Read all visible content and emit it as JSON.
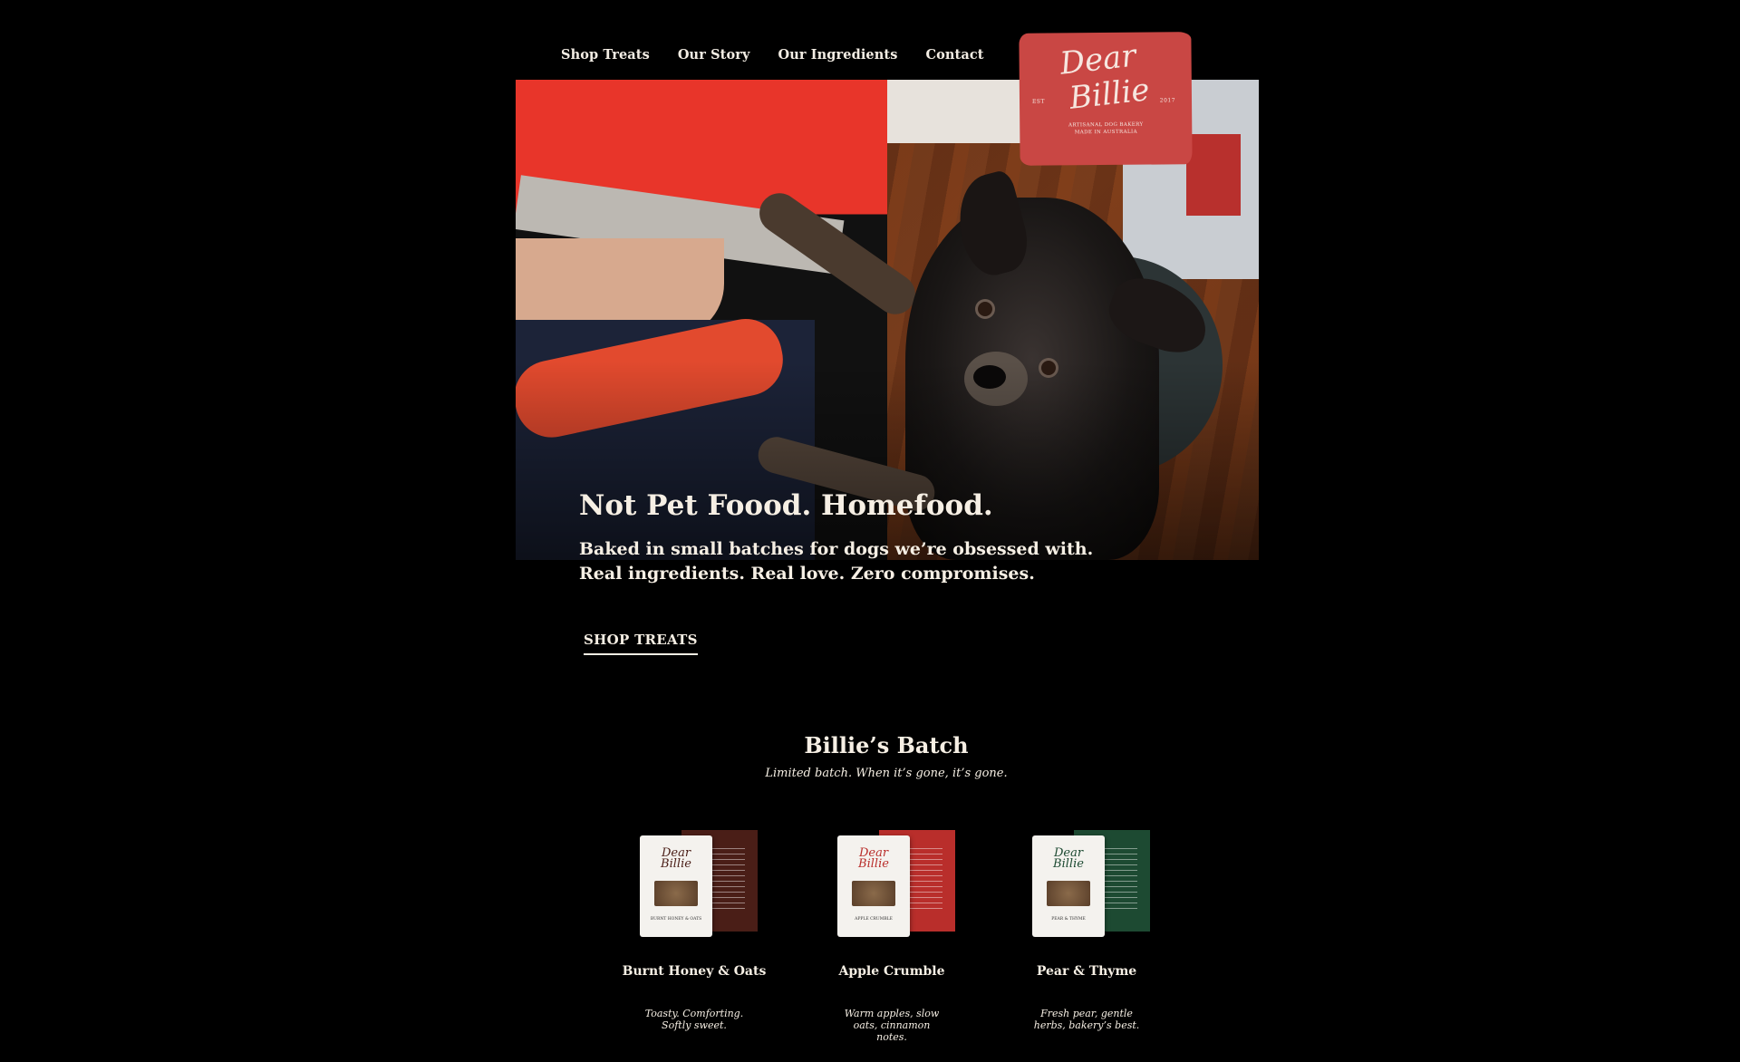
{
  "nav": {
    "items": [
      {
        "label": "Shop Treats"
      },
      {
        "label": "Our Story"
      },
      {
        "label": "Our Ingredients"
      },
      {
        "label": "Contact"
      }
    ]
  },
  "logo": {
    "line1": "Dear",
    "line2": "Billie",
    "est": "EST",
    "year": "2017",
    "tagline1": "ARTISANAL DOG BAKERY",
    "tagline2": "MADE IN AUSTRALIA"
  },
  "hero": {
    "headline": "Not Pet Foood. Homefood.",
    "lede_line1": "Baked in small batches for dogs we’re obsessed with.",
    "lede_line2": "Real ingredients. Real love. Zero compromises.",
    "cta_label": "SHOP TREATS"
  },
  "batch": {
    "title": "Billie’s Batch",
    "subtitle": "Limited batch. When it’s gone, it’s gone."
  },
  "products": [
    {
      "name": "Burnt Honey & Oats",
      "desc_line1": "Toasty. Comforting.",
      "desc_line2": "Softly sweet.",
      "accent": "#4a1e17",
      "pack_label": "BURNT HONEY & OATS"
    },
    {
      "name": "Apple Crumble",
      "desc_line1": "Warm apples, slow",
      "desc_line2": "oats, cinnamon notes.",
      "accent": "#b92e2b",
      "pack_label": "APPLE CRUMBLE"
    },
    {
      "name": "Pear & Thyme",
      "desc_line1": "Fresh pear, gentle",
      "desc_line2": "herbs, bakery’s best.",
      "accent": "#1d4a32",
      "pack_label": "PEAR & THYME"
    }
  ],
  "colors": {
    "background": "#000000",
    "text": "#f6efe4",
    "logo": "#c94744"
  }
}
